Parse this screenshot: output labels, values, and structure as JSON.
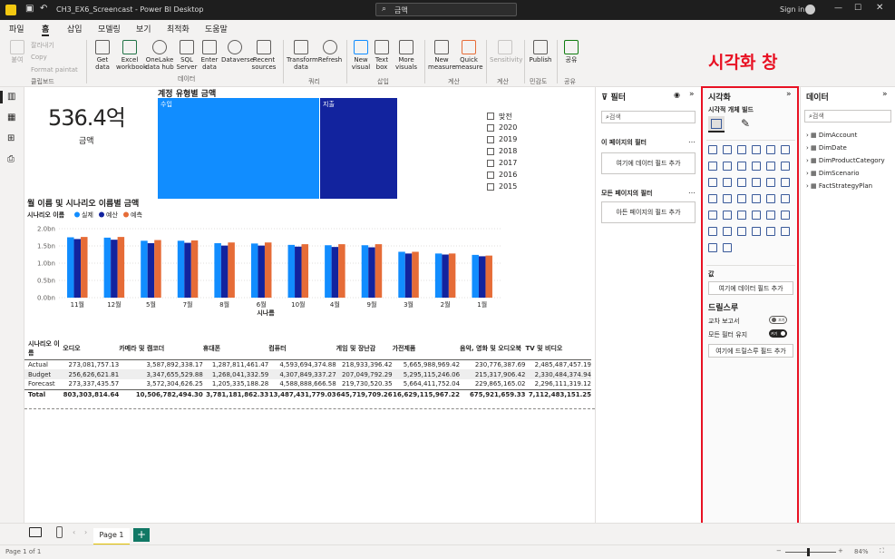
{
  "titlebar": {
    "file_name": "CH3_EX6_Screencast - Power BI Desktop",
    "search": "금액",
    "sign_in": "Sign in"
  },
  "menu": [
    "파일",
    "홈",
    "삽입",
    "모델링",
    "보기",
    "최적화",
    "도움말"
  ],
  "ribbon": {
    "clipboard": {
      "paste": "붙여",
      "cut": "잘라내기",
      "copy": "Copy",
      "format": "Format paintat",
      "group": "클립보드"
    },
    "data": {
      "items": [
        "Get data",
        "Excel workbook",
        "OneLake data hub",
        "SQL Server",
        "Enter data",
        "Dataverse",
        "Recent sources"
      ],
      "group": "데이터"
    },
    "queries": {
      "items": [
        "Transform data",
        "Refresh"
      ],
      "group": "쿼리"
    },
    "insert": {
      "items": [
        "New visual",
        "Text box",
        "More visuals"
      ],
      "group": "삽입"
    },
    "calc": {
      "items": [
        "New measure",
        "Quick measure"
      ],
      "group": "계산"
    },
    "sens": {
      "items": [
        "Sensitivity"
      ],
      "group": "계산"
    },
    "share": {
      "items": [
        "Publish"
      ],
      "group": "민감도"
    },
    "share2": {
      "items": [
        "공유"
      ],
      "group": "공유"
    }
  },
  "annotation": "시각화 창",
  "card": {
    "value": "536.4억",
    "label": "금액"
  },
  "treemap": {
    "title": "계정 유형별 금액",
    "seg1": "수입",
    "seg2": "지출"
  },
  "slicer": {
    "items": [
      "맞전",
      "2020",
      "2019",
      "2018",
      "2017",
      "2016",
      "2015"
    ]
  },
  "chart_data": {
    "type": "bar",
    "title": "월 이름 및 시나리오 이름별 금액",
    "legend_title": "시나리오 이름",
    "xlabel": "시나름",
    "categories": [
      "11월",
      "12월",
      "5월",
      "7월",
      "8월",
      "6월",
      "10월",
      "4월",
      "9월",
      "3월",
      "2월",
      "1월"
    ],
    "yticks": [
      "2.0bn",
      "1.5bn",
      "1.0bn",
      "0.5bn",
      "0.0bn"
    ],
    "ylim": [
      0,
      2.0
    ],
    "series": [
      {
        "name": "실제",
        "color": "#118DFF",
        "values": [
          1.75,
          1.74,
          1.65,
          1.65,
          1.58,
          1.57,
          1.53,
          1.52,
          1.52,
          1.33,
          1.28,
          1.24
        ]
      },
      {
        "name": "예산",
        "color": "#12239E",
        "values": [
          1.7,
          1.68,
          1.58,
          1.59,
          1.51,
          1.51,
          1.48,
          1.47,
          1.46,
          1.28,
          1.25,
          1.2
        ]
      },
      {
        "name": "예측",
        "color": "#E66C37",
        "values": [
          1.76,
          1.76,
          1.67,
          1.66,
          1.6,
          1.6,
          1.55,
          1.55,
          1.55,
          1.33,
          1.28,
          1.22
        ]
      }
    ]
  },
  "matrix": {
    "headers": [
      "시나리오 이름",
      "오디오",
      "카메라 및 캠코더",
      "휴대폰",
      "컴퓨터",
      "게임 및 장난감",
      "가전제품",
      "음악, 영화 및 오디오북",
      "TV 및 비디오"
    ],
    "rows": [
      [
        "Actual",
        "273,081,757.13",
        "3,587,892,338.17",
        "1,287,811,461.47",
        "4,593,694,374.88",
        "218,933,396.42",
        "5,665,988,969.42",
        "230,776,387.69",
        "2,485,487,457.19"
      ],
      [
        "Budget",
        "256,626,621.81",
        "3,347,655,529.88",
        "1,268,041,332.59",
        "4,307,849,337.27",
        "207,049,792.29",
        "5,295,115,246.06",
        "215,317,906.42",
        "2,330,484,374.94"
      ],
      [
        "Forecast",
        "273,337,435.57",
        "3,572,304,626.25",
        "1,205,335,188.28",
        "4,588,888,666.58",
        "219,730,520.35",
        "5,664,411,752.04",
        "229,865,165.02",
        "2,296,111,319.12"
      ],
      [
        "Total",
        "803,303,814.64",
        "10,506,782,494.30",
        "3,781,181,862.33",
        "13,487,431,779.03",
        "645,719,709.26",
        "16,629,115,967.22",
        "675,921,659.33",
        "7,112,483,151.25"
      ]
    ]
  },
  "filters": {
    "title": "필터",
    "search": "검색",
    "page_filters": "이 페이지의 필터",
    "page_add": "여기에 데이터 필드 추가",
    "all_filters": "모든 페이지의 필터",
    "all_add": "아든 페이지의 필드 추가"
  },
  "viz": {
    "title": "시각화",
    "build": "시각적 개체 빌드",
    "values": "값",
    "values_add": "여기에 데이터 필드 추가",
    "drill": "드릴스루",
    "cross": "교차 보고서",
    "cross_state": "끄기",
    "keep": "모든 필터 유지",
    "keep_state": "켜기",
    "drill_add": "여기에 드릴스루 필드 추가"
  },
  "datapane": {
    "title": "데이터",
    "search": "검색",
    "tables": [
      "DimAccount",
      "DimDate",
      "DimProductCategory",
      "DimScenario",
      "FactStrategyPlan"
    ]
  },
  "pages": {
    "tab": "Page 1"
  },
  "status": {
    "page": "Page 1 of 1",
    "zoom": "84%"
  },
  "colors": {
    "accent": "#118DFF",
    "annotation": "#E81123"
  }
}
